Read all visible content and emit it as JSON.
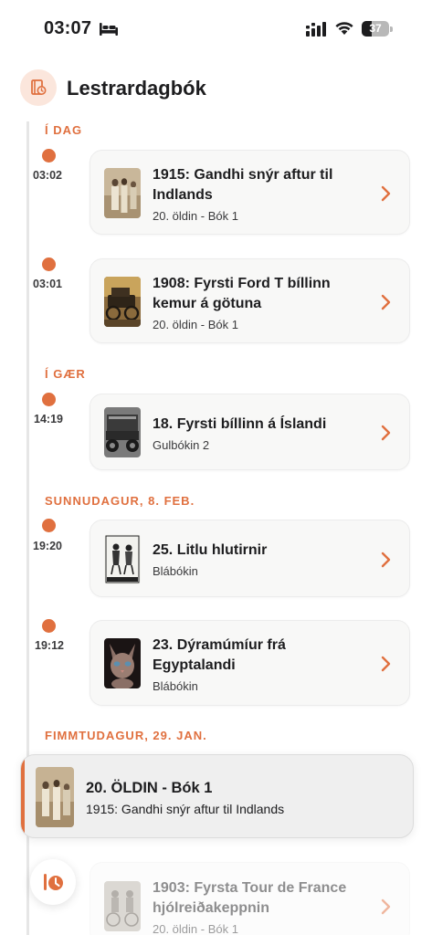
{
  "status_bar": {
    "time": "03:07",
    "battery": "37",
    "battery_level": 0.37,
    "icons": [
      "bed-icon",
      "cellular-signal-icon",
      "wifi-icon",
      "battery-icon"
    ]
  },
  "header": {
    "title": "Lestrardagbók",
    "icon": "reading-history-icon"
  },
  "accent_color": "#e0703f",
  "sections": [
    {
      "label": "Í DAG",
      "entries": [
        {
          "time": "03:02",
          "title_line1": "1915: Gandhi snýr aftur til",
          "title_line2": "Indlands",
          "subtitle": "20. öldin - Bók 1"
        },
        {
          "time": "03:01",
          "title_line1": "1908: Fyrsti Ford T bíllinn",
          "title_line2": "kemur á götuna",
          "subtitle": "20. öldin - Bók 1"
        }
      ]
    },
    {
      "label": "Í GÆR",
      "entries": [
        {
          "time": "14:19",
          "title_line1": "18. Fyrsti bíllinn á Íslandi",
          "title_line2": "",
          "subtitle": "Gulbókin 2"
        }
      ]
    },
    {
      "label": "SUNNUDAGUR, 8. FEB.",
      "entries": [
        {
          "time": "19:20",
          "title_line1": "25. Litlu hlutirnir",
          "title_line2": "",
          "subtitle": "Blábókin"
        },
        {
          "time": "19:12",
          "title_line1": "23. Dýramúmíur frá",
          "title_line2": "Egyptalandi",
          "subtitle": "Blábókin"
        }
      ]
    },
    {
      "label": "FIMMTUDAGUR, 29. JAN.",
      "entries": [
        {
          "time": "",
          "title_line1": "1903: Fyrsta Tour de France",
          "title_line2": "hjólreiðakeppnin",
          "subtitle": "20. öldin - Bók 1"
        }
      ]
    }
  ],
  "now_playing": {
    "title": "20. ÖLDIN - Bók 1",
    "subtitle": "1915: Gandhi snýr aftur til Indlands"
  },
  "fab": {
    "icon": "history-clock-icon"
  }
}
